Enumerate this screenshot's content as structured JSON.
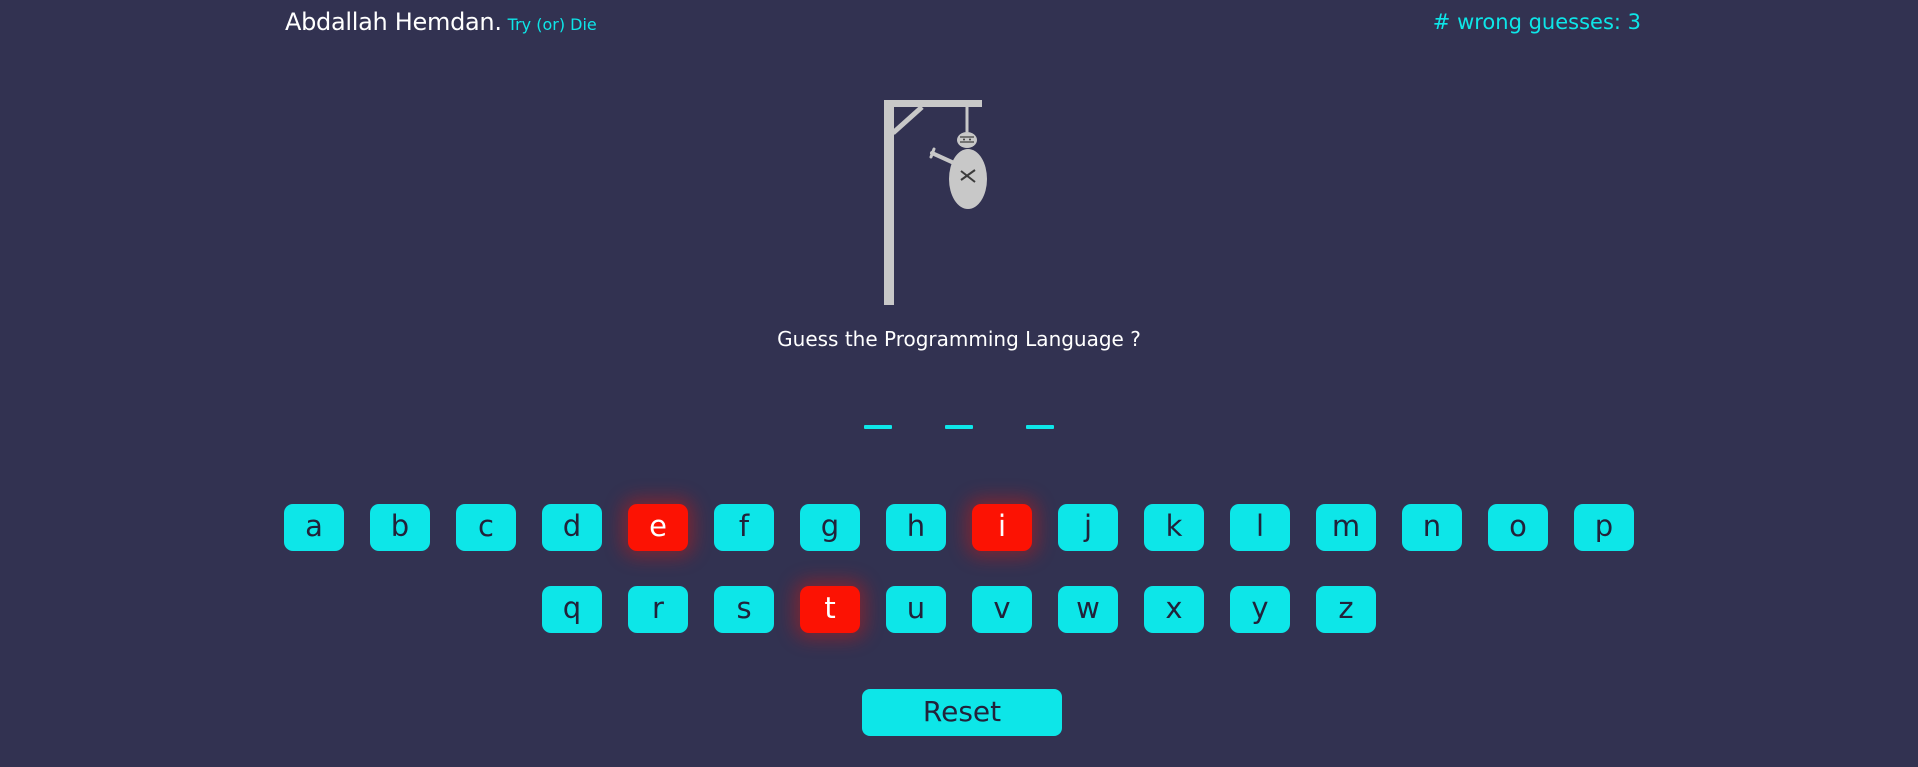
{
  "header": {
    "brand_name": "Abdallah Hemdan.",
    "brand_tagline": "Try (or) Die",
    "wrong_guesses_text": "# wrong guesses: 3"
  },
  "game": {
    "question": "Guess the Programming Language ?",
    "word_length": 3,
    "wrong_guesses": 3,
    "wrong_letters": [
      "e",
      "i",
      "t"
    ]
  },
  "keyboard": {
    "row1": [
      "a",
      "b",
      "c",
      "d",
      "e",
      "f",
      "g",
      "h",
      "i",
      "j",
      "k",
      "l",
      "m",
      "n",
      "o",
      "p"
    ],
    "row2": [
      "q",
      "r",
      "s",
      "t",
      "u",
      "v",
      "w",
      "x",
      "y",
      "z"
    ]
  },
  "controls": {
    "reset_label": "Reset"
  },
  "colors": {
    "background": "#323251",
    "accent": "#0de6e8",
    "wrong": "#fc1203",
    "gallows": "#c8c8c8"
  }
}
